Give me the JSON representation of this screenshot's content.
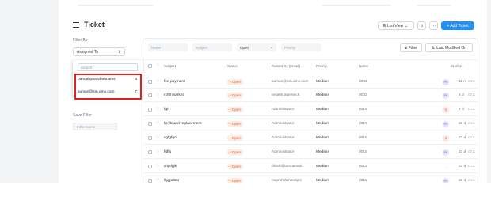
{
  "header": {
    "title": "Ticket",
    "list_view": "List View",
    "more": "···",
    "add": "+ Add Ticket",
    "refresh_icon": "↻"
  },
  "sidebar": {
    "filter_by": "Filter By",
    "assigned_to": "Assigned To",
    "search_placeholder": "Search",
    "options": [
      {
        "label": "parvathynandana.ams",
        "count": "8"
      },
      {
        "label": "saman@sm.ams.com",
        "count": "7"
      }
    ],
    "save_filter": "Save Filter",
    "filter_name_placeholder": "Filter Name"
  },
  "filters": {
    "name": "Name",
    "subject": "Subject",
    "status": "Open",
    "priority": "Priority",
    "filter_btn": "Filter",
    "sort_btn": "Last Modified On"
  },
  "table": {
    "headers": {
      "subject": "Subject",
      "status": "Status",
      "raised_by": "Raised By (Email)",
      "priority": "Priority",
      "name": "Name",
      "count": "11 of 11"
    },
    "rows": [
      {
        "subject": "fee payment",
        "status": "Open",
        "raised_by": "saman@sm.ams.com",
        "priority": "Medium",
        "name": "0004",
        "avatar": "PV",
        "time": "11 m",
        "comments": "1"
      },
      {
        "subject": "rcftll market",
        "status": "Open",
        "raised_by": "tenjeth.inpretech",
        "priority": "Medium",
        "name": "0003",
        "avatar": "PV",
        "time": "4 d",
        "comments": "1"
      },
      {
        "subject": "fgh",
        "status": "Open",
        "raised_by": "Administrator",
        "priority": "Medium",
        "name": "0019",
        "avatar": "S",
        "time": "4 d",
        "comments": "1"
      },
      {
        "subject": "keyboard replacement",
        "status": "Open",
        "raised_by": "Administrator",
        "priority": "Medium",
        "name": "0017",
        "avatar": "PV",
        "time": "23 d",
        "comments": "1"
      },
      {
        "subject": "vgfgfgm",
        "status": "Open",
        "raised_by": "Administrator",
        "priority": "Medium",
        "name": "0016",
        "avatar": "S",
        "time": "23 d",
        "comments": "1"
      },
      {
        "subject": "fgfhj",
        "status": "Open",
        "raised_by": "Administrator",
        "priority": "Medium",
        "name": "0015",
        "avatar": "PV",
        "time": "23 d",
        "comments": "1"
      },
      {
        "subject": "xhjsfgjk",
        "status": "Open",
        "raised_by": "dhishi@am.amsth",
        "priority": "Medium",
        "name": "0012",
        "avatar": "-",
        "time": "23 d",
        "comments": "1"
      },
      {
        "subject": "lkjgpdtmr",
        "status": "Open",
        "raised_by": "bnpruhvkmantiple",
        "priority": "Medium",
        "name": "0011",
        "avatar": "PV",
        "time": "23 d",
        "comments": "1"
      }
    ]
  },
  "colors": {
    "accent": "#2490ef",
    "highlight": "#e0201d",
    "status": "#e05f2a"
  }
}
